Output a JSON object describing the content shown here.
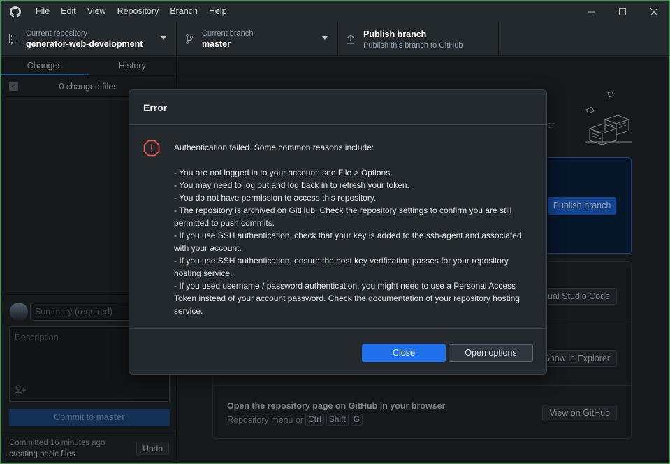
{
  "menu": {
    "items": [
      "File",
      "Edit",
      "View",
      "Repository",
      "Branch",
      "Help"
    ]
  },
  "toolbar": {
    "repo_label": "Current repository",
    "repo_value": "generator-web-development",
    "branch_label": "Current branch",
    "branch_value": "master",
    "publish_label": "Publish branch",
    "publish_sub": "Publish this branch to GitHub"
  },
  "sidebar": {
    "tab_changes": "Changes",
    "tab_history": "History",
    "changed_files": "0 changed files",
    "summary_placeholder": "Summary (required)",
    "description_placeholder": "Description",
    "commit_prefix": "Commit to ",
    "commit_branch": "master",
    "last_commit_label": "Committed 16 minutes ago",
    "last_commit_message": "creating basic files",
    "undo_label": "Undo"
  },
  "main": {
    "or_text": "or",
    "publish_button": "Publish branch",
    "open_editor_button": "sual Studio Code",
    "show_explorer_button": "Show in Explorer",
    "github_row_title": "Open the repository page on GitHub in your browser",
    "github_row_sub": "Repository menu or",
    "kbd_ctrl": "Ctrl",
    "kbd_shift": "Shift",
    "kbd_g": "G",
    "view_github_button": "View on GitHub"
  },
  "dialog": {
    "title": "Error",
    "intro": "Authentication failed. Some common reasons include:",
    "reasons": [
      "- You are not logged in to your account: see File > Options.",
      "- You may need to log out and log back in to refresh your token.",
      "- You do not have permission to access this repository.",
      "- The repository is archived on GitHub. Check the repository settings to confirm you are still permitted to push commits.",
      "- If you use SSH authentication, check that your key is added to the ssh-agent and associated with your account.",
      "- If you use SSH authentication, ensure the host key verification passes for your repository hosting service.",
      "- If you used username / password authentication, you might need to use a Personal Access Token instead of your account password. Check the documentation of your repository hosting service."
    ],
    "close_button": "Close",
    "options_button": "Open options"
  },
  "colors": {
    "accent": "#1f6feb",
    "error": "#f85149",
    "background": "#24292e"
  }
}
